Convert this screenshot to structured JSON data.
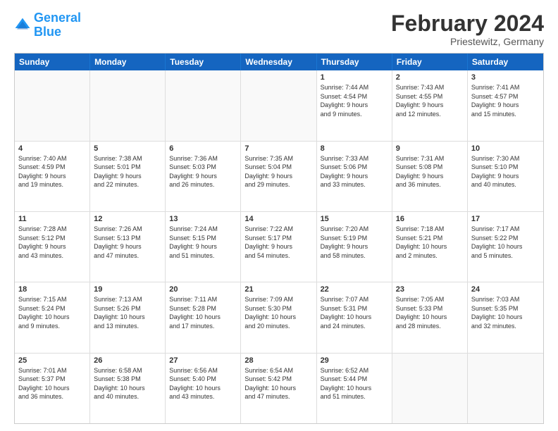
{
  "header": {
    "logo_line1": "General",
    "logo_line2": "Blue",
    "title": "February 2024",
    "subtitle": "Priestewitz, Germany"
  },
  "days_of_week": [
    "Sunday",
    "Monday",
    "Tuesday",
    "Wednesday",
    "Thursday",
    "Friday",
    "Saturday"
  ],
  "rows": [
    [
      {
        "num": "",
        "info": "",
        "empty": true
      },
      {
        "num": "",
        "info": "",
        "empty": true
      },
      {
        "num": "",
        "info": "",
        "empty": true
      },
      {
        "num": "",
        "info": "",
        "empty": true
      },
      {
        "num": "1",
        "info": "Sunrise: 7:44 AM\nSunset: 4:54 PM\nDaylight: 9 hours\nand 9 minutes.",
        "empty": false
      },
      {
        "num": "2",
        "info": "Sunrise: 7:43 AM\nSunset: 4:55 PM\nDaylight: 9 hours\nand 12 minutes.",
        "empty": false
      },
      {
        "num": "3",
        "info": "Sunrise: 7:41 AM\nSunset: 4:57 PM\nDaylight: 9 hours\nand 15 minutes.",
        "empty": false
      }
    ],
    [
      {
        "num": "4",
        "info": "Sunrise: 7:40 AM\nSunset: 4:59 PM\nDaylight: 9 hours\nand 19 minutes.",
        "empty": false
      },
      {
        "num": "5",
        "info": "Sunrise: 7:38 AM\nSunset: 5:01 PM\nDaylight: 9 hours\nand 22 minutes.",
        "empty": false
      },
      {
        "num": "6",
        "info": "Sunrise: 7:36 AM\nSunset: 5:03 PM\nDaylight: 9 hours\nand 26 minutes.",
        "empty": false
      },
      {
        "num": "7",
        "info": "Sunrise: 7:35 AM\nSunset: 5:04 PM\nDaylight: 9 hours\nand 29 minutes.",
        "empty": false
      },
      {
        "num": "8",
        "info": "Sunrise: 7:33 AM\nSunset: 5:06 PM\nDaylight: 9 hours\nand 33 minutes.",
        "empty": false
      },
      {
        "num": "9",
        "info": "Sunrise: 7:31 AM\nSunset: 5:08 PM\nDaylight: 9 hours\nand 36 minutes.",
        "empty": false
      },
      {
        "num": "10",
        "info": "Sunrise: 7:30 AM\nSunset: 5:10 PM\nDaylight: 9 hours\nand 40 minutes.",
        "empty": false
      }
    ],
    [
      {
        "num": "11",
        "info": "Sunrise: 7:28 AM\nSunset: 5:12 PM\nDaylight: 9 hours\nand 43 minutes.",
        "empty": false
      },
      {
        "num": "12",
        "info": "Sunrise: 7:26 AM\nSunset: 5:13 PM\nDaylight: 9 hours\nand 47 minutes.",
        "empty": false
      },
      {
        "num": "13",
        "info": "Sunrise: 7:24 AM\nSunset: 5:15 PM\nDaylight: 9 hours\nand 51 minutes.",
        "empty": false
      },
      {
        "num": "14",
        "info": "Sunrise: 7:22 AM\nSunset: 5:17 PM\nDaylight: 9 hours\nand 54 minutes.",
        "empty": false
      },
      {
        "num": "15",
        "info": "Sunrise: 7:20 AM\nSunset: 5:19 PM\nDaylight: 9 hours\nand 58 minutes.",
        "empty": false
      },
      {
        "num": "16",
        "info": "Sunrise: 7:18 AM\nSunset: 5:21 PM\nDaylight: 10 hours\nand 2 minutes.",
        "empty": false
      },
      {
        "num": "17",
        "info": "Sunrise: 7:17 AM\nSunset: 5:22 PM\nDaylight: 10 hours\nand 5 minutes.",
        "empty": false
      }
    ],
    [
      {
        "num": "18",
        "info": "Sunrise: 7:15 AM\nSunset: 5:24 PM\nDaylight: 10 hours\nand 9 minutes.",
        "empty": false
      },
      {
        "num": "19",
        "info": "Sunrise: 7:13 AM\nSunset: 5:26 PM\nDaylight: 10 hours\nand 13 minutes.",
        "empty": false
      },
      {
        "num": "20",
        "info": "Sunrise: 7:11 AM\nSunset: 5:28 PM\nDaylight: 10 hours\nand 17 minutes.",
        "empty": false
      },
      {
        "num": "21",
        "info": "Sunrise: 7:09 AM\nSunset: 5:30 PM\nDaylight: 10 hours\nand 20 minutes.",
        "empty": false
      },
      {
        "num": "22",
        "info": "Sunrise: 7:07 AM\nSunset: 5:31 PM\nDaylight: 10 hours\nand 24 minutes.",
        "empty": false
      },
      {
        "num": "23",
        "info": "Sunrise: 7:05 AM\nSunset: 5:33 PM\nDaylight: 10 hours\nand 28 minutes.",
        "empty": false
      },
      {
        "num": "24",
        "info": "Sunrise: 7:03 AM\nSunset: 5:35 PM\nDaylight: 10 hours\nand 32 minutes.",
        "empty": false
      }
    ],
    [
      {
        "num": "25",
        "info": "Sunrise: 7:01 AM\nSunset: 5:37 PM\nDaylight: 10 hours\nand 36 minutes.",
        "empty": false
      },
      {
        "num": "26",
        "info": "Sunrise: 6:58 AM\nSunset: 5:38 PM\nDaylight: 10 hours\nand 40 minutes.",
        "empty": false
      },
      {
        "num": "27",
        "info": "Sunrise: 6:56 AM\nSunset: 5:40 PM\nDaylight: 10 hours\nand 43 minutes.",
        "empty": false
      },
      {
        "num": "28",
        "info": "Sunrise: 6:54 AM\nSunset: 5:42 PM\nDaylight: 10 hours\nand 47 minutes.",
        "empty": false
      },
      {
        "num": "29",
        "info": "Sunrise: 6:52 AM\nSunset: 5:44 PM\nDaylight: 10 hours\nand 51 minutes.",
        "empty": false
      },
      {
        "num": "",
        "info": "",
        "empty": true
      },
      {
        "num": "",
        "info": "",
        "empty": true
      }
    ]
  ]
}
